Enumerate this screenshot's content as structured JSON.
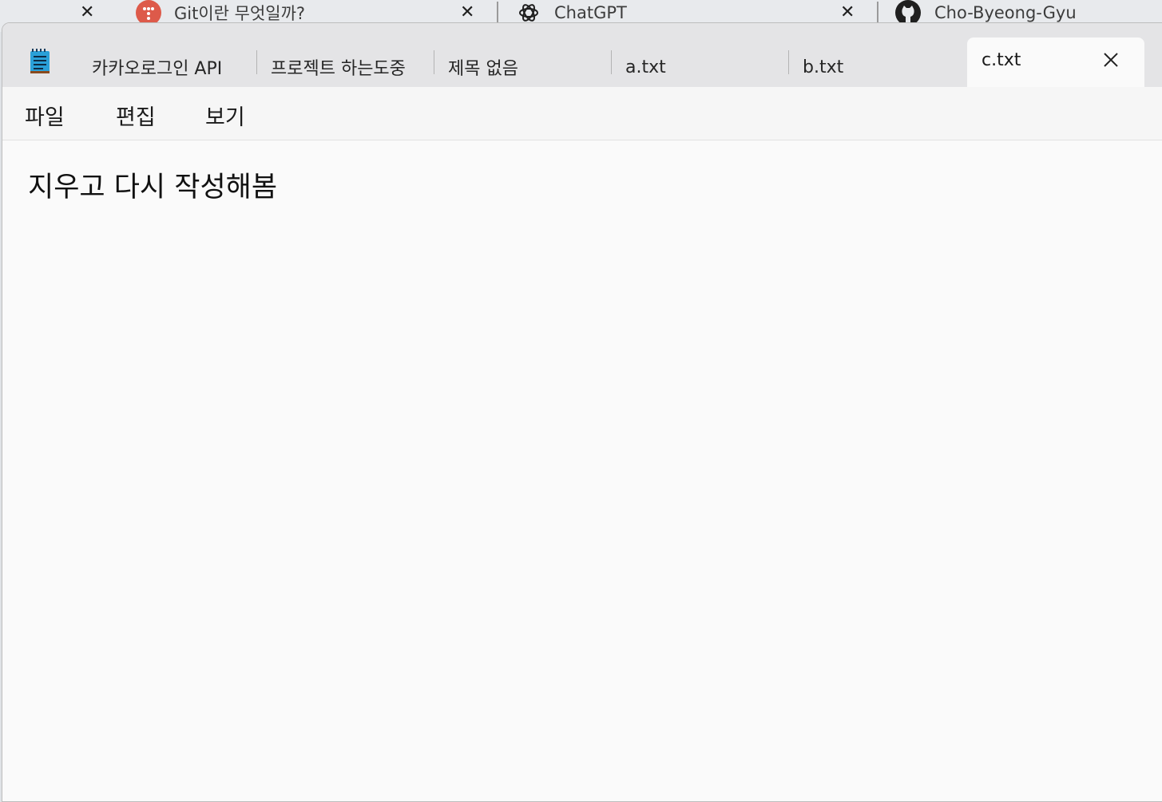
{
  "browser_tabs": [
    {
      "title": "Git이란 무엇일까?",
      "icon": "git-logo-icon",
      "icon_color": "#dd5a4a"
    },
    {
      "title": "ChatGPT",
      "icon": "chatgpt-logo-icon"
    },
    {
      "title": "Cho-Byeong-Gyu",
      "icon": "github-logo-icon"
    }
  ],
  "notepad": {
    "tabs": [
      {
        "title": "카카오로그인 API"
      },
      {
        "title": "프로젝트 하는도중"
      },
      {
        "title": "제목 없음"
      },
      {
        "title": "a.txt"
      },
      {
        "title": "b.txt"
      }
    ],
    "active_tab": {
      "title": "c.txt"
    },
    "menu": {
      "file": "파일",
      "edit": "편집",
      "view": "보기"
    },
    "content": "지우고 다시 작성해봄",
    "accent_color": "#2aa0d8"
  }
}
